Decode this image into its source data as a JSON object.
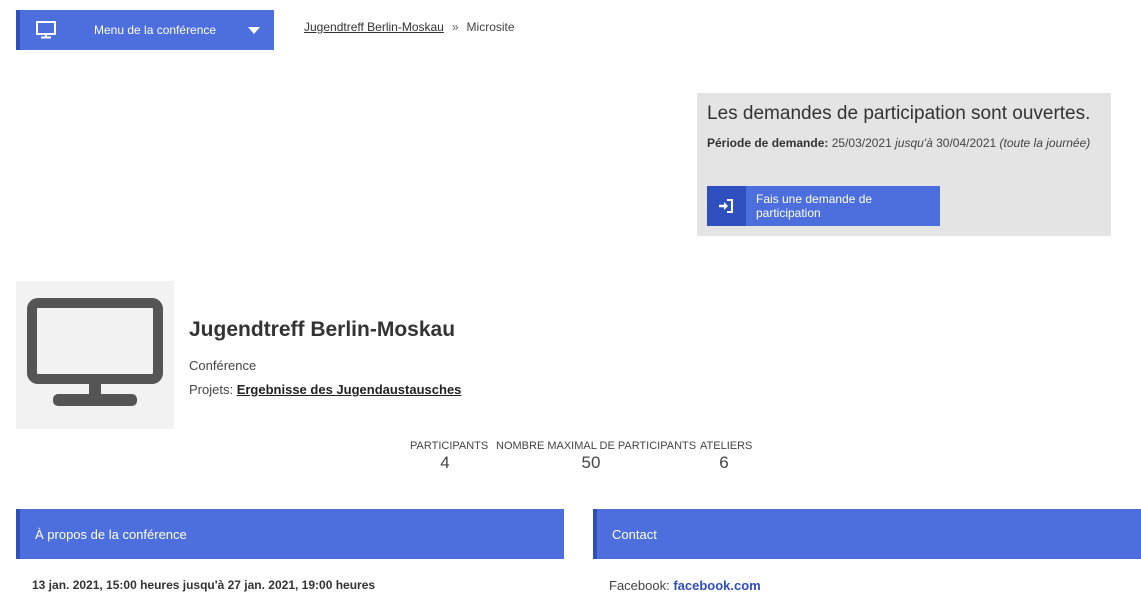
{
  "menu": {
    "label": "Menu de la conférence",
    "icon": "monitor-icon"
  },
  "breadcrumb": {
    "link": "Jugendtreff Berlin-Moskau",
    "separator": "»",
    "current": "Microsite"
  },
  "application": {
    "title": "Les demandes de participation sont ouvertes.",
    "period_label": "Période de demande:",
    "start": "25/03/2021",
    "until": "jusqu'à",
    "end": "30/04/2021",
    "note": "(toute la journée)",
    "button_label": "Fais une demande de participation",
    "button_icon": "sign-in-icon"
  },
  "conference": {
    "title": "Jugendtreff Berlin-Moskau",
    "type": "Conférence",
    "projects_label": "Projets:",
    "project_link": "Ergebnisse des Jugendaustausches"
  },
  "stats": [
    {
      "label": "PARTICIPANTS",
      "value": "4"
    },
    {
      "label": "NOMBRE MAXIMAL DE PARTICIPANTS",
      "value": "50"
    },
    {
      "label": "ATELIERS",
      "value": "6"
    }
  ],
  "about": {
    "heading": "À propos de la conférence",
    "dates": "13 jan. 2021, 15:00 heures jusqu'à 27 jan. 2021, 19:00 heures"
  },
  "contact": {
    "heading": "Contact",
    "facebook_label": "Facebook:",
    "facebook_link": "facebook.com"
  },
  "colors": {
    "accent": "#4d6fdd",
    "accent_dark": "#2f4fbf",
    "panel_bg": "#e4e4e4"
  }
}
